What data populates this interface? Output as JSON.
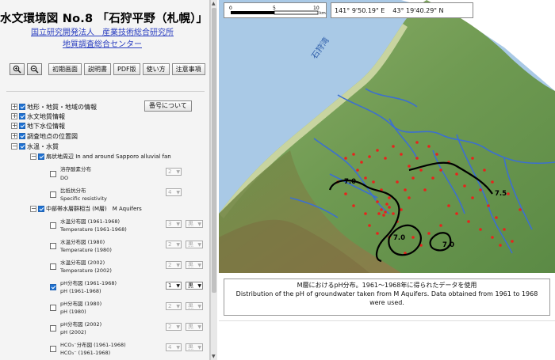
{
  "header": {
    "title": "水文環境図 No.8 「石狩平野（札幌）」",
    "org1": "国立研究開発法人　産業技術総合研究所",
    "org2": "地質調査総合センター"
  },
  "toolbar": {
    "buttons": [
      "初期画面",
      "説明書",
      "PDF版",
      "使い方",
      "注意事項"
    ]
  },
  "layers": {
    "number_button": "番号について",
    "groups": [
      "地形・地質・地域の情報",
      "水文地質情報",
      "地下水位情報",
      "調査地点の位置図",
      "水温・水質"
    ],
    "sub_fan": "扇状地周辺 In and around Sapporo alluvial fan",
    "sub_aq": "中部帯水層群相当 (M層)　M Aquifers",
    "items": [
      {
        "ja": "溶存酸素分布",
        "en": "DO",
        "sel": "2"
      },
      {
        "ja": "比抵抗分布",
        "en": "Specific resistivity",
        "sel": "4"
      },
      {
        "ja": "水温分布図 (1961-1968)",
        "en": "Temperature  (1961-1968)",
        "sel": "3",
        "color": "黒"
      },
      {
        "ja": "水温分布図 (1980)",
        "en": "Temperature  (1980)",
        "sel": "2",
        "color": "黒"
      },
      {
        "ja": "水温分布図 (2002)",
        "en": "Temperature  (2002)",
        "sel": "2",
        "color": "黒"
      },
      {
        "ja": "pH分布図 (1961-1968)",
        "en": "pH (1961-1968)",
        "sel": "1",
        "color": "黒"
      },
      {
        "ja": "pH分布図 (1980)",
        "en": "pH (1980)",
        "sel": "2",
        "color": "黒"
      },
      {
        "ja": "pH分布図 (2002)",
        "en": "pH (2002)",
        "sel": "2",
        "color": "黒"
      },
      {
        "ja": "HCO₃⁻分布図 (1961-1968)",
        "en": "HCO₃⁻ (1961-1968)",
        "sel": "4",
        "color": "黒"
      }
    ]
  },
  "scale": {
    "labels": [
      "0",
      "5",
      "10"
    ],
    "unit": "km"
  },
  "coords": {
    "lon": "141°  9'50.19\" E",
    "lat": "43°  19'40.29\" N"
  },
  "map": {
    "bay_label": "石狩湾",
    "contours": [
      "7.0",
      "7.5",
      "7.0",
      "7.0"
    ],
    "colors": {
      "sea": "#a9c9e6",
      "land": "#6f9a52",
      "river": "#3c6fd0",
      "points": "#e8231c",
      "contour": "#000000"
    }
  },
  "caption": {
    "ja": "M層におけるpH分布。1961～1968年に得られたデータを使用",
    "en": "Distribution of the pH of groundwater taken from M Aquifers. Data obtained from 1961 to 1968 were used."
  }
}
